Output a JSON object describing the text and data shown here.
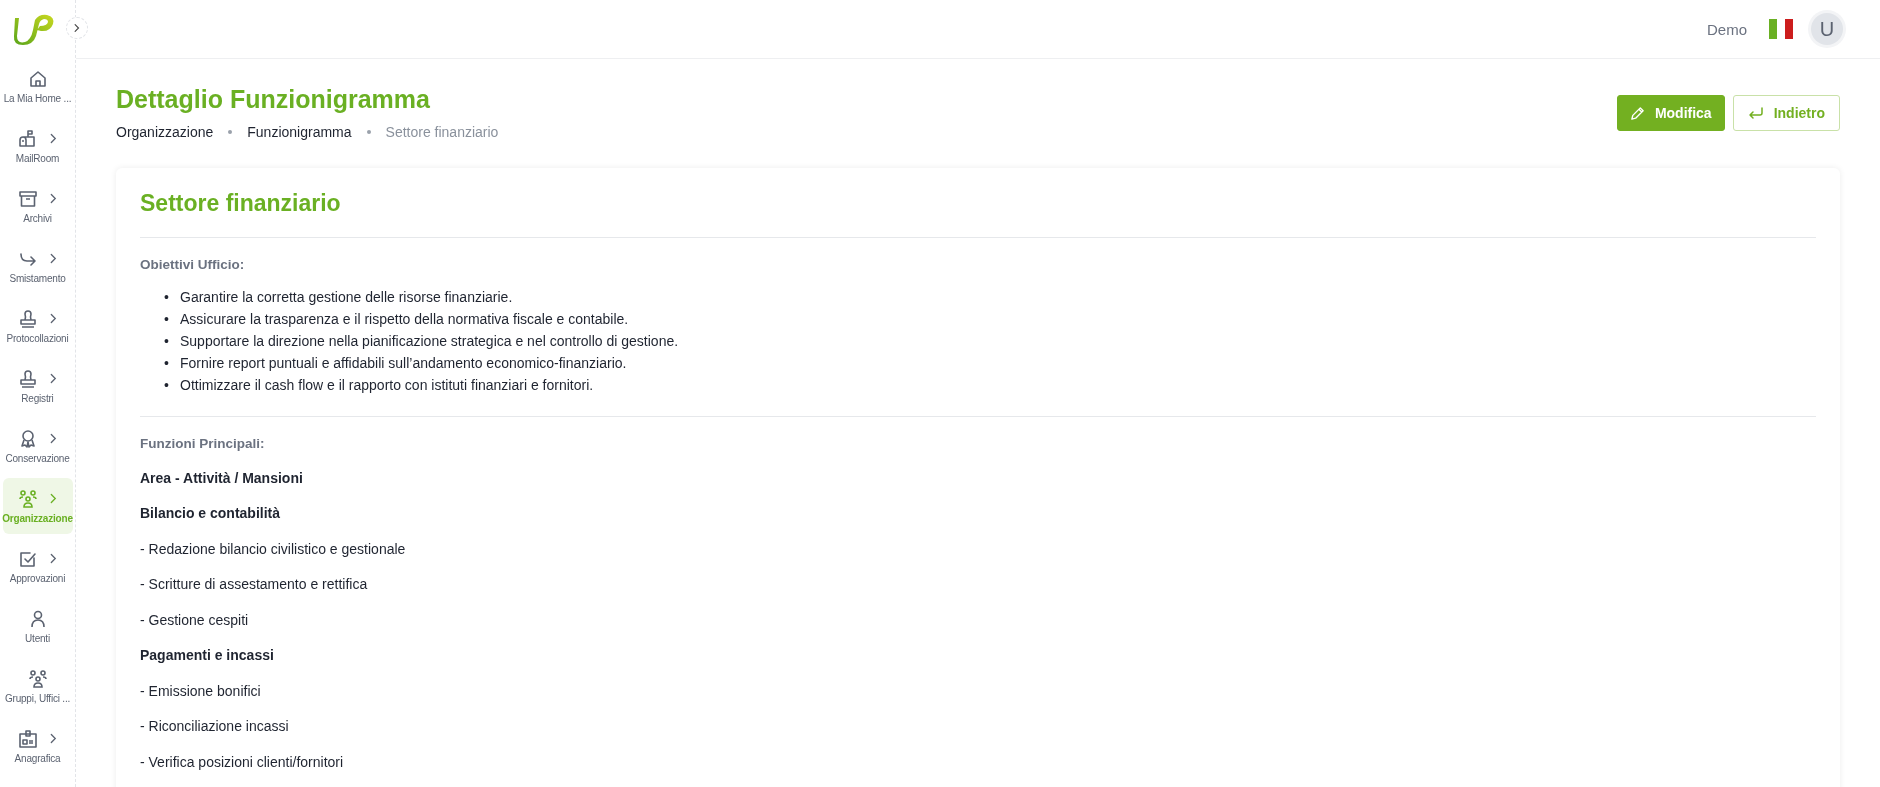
{
  "header": {
    "user_name": "Demo",
    "avatar_initial": "U"
  },
  "sidebar": {
    "items": [
      {
        "label": "La Mia Home ...",
        "submenu": false,
        "selected": false
      },
      {
        "label": "MailRoom",
        "submenu": true,
        "selected": false
      },
      {
        "label": "Archivi",
        "submenu": true,
        "selected": false
      },
      {
        "label": "Smistamento",
        "submenu": true,
        "selected": false
      },
      {
        "label": "Protocollazioni",
        "submenu": true,
        "selected": false
      },
      {
        "label": "Registri",
        "submenu": true,
        "selected": false
      },
      {
        "label": "Conservazione",
        "submenu": true,
        "selected": false
      },
      {
        "label": "Organizzazione",
        "submenu": true,
        "selected": true
      },
      {
        "label": "Approvazioni",
        "submenu": true,
        "selected": false
      },
      {
        "label": "Utenti",
        "submenu": false,
        "selected": false
      },
      {
        "label": "Gruppi, Uffici ...",
        "submenu": false,
        "selected": false
      },
      {
        "label": "Anagrafica",
        "submenu": true,
        "selected": false
      }
    ]
  },
  "page": {
    "title": "Dettaglio Funzionigramma",
    "breadcrumb": [
      {
        "label": "Organizzazione",
        "current": false
      },
      {
        "label": "Funzionigramma",
        "current": false
      },
      {
        "label": "Settore finanziario",
        "current": true
      }
    ],
    "buttons": [
      {
        "label": "Modifica",
        "kind": "primary"
      },
      {
        "label": "Indietro",
        "kind": "outline"
      }
    ]
  },
  "card": {
    "title": "Settore finanziario",
    "objectives": {
      "label": "Obiettivi Ufficio:",
      "items": [
        {
          "marker": "•",
          "text": "Garantire la corretta gestione delle risorse finanziarie."
        },
        {
          "marker": "•",
          "text": "Assicurare la trasparenza e il rispetto della normativa fiscale e contabile."
        },
        {
          "marker": "•",
          "text": "Supportare la direzione nella pianificazione strategica e nel controllo di gestione."
        },
        {
          "marker": "•",
          "text": "Fornire report puntuali e affidabili sull’andamento economico-finanziario."
        },
        {
          "marker": "•",
          "text": "Ottimizzare il cash flow e il rapporto con istituti finanziari e fornitori."
        }
      ]
    },
    "functions": {
      "label": "Funzioni Principali:",
      "lines": [
        {
          "kind": "heading",
          "text": "Area - Attività / Mansioni"
        },
        {
          "kind": "heading",
          "text": "Bilancio e contabilità"
        },
        {
          "kind": "item",
          "text": "- Redazione bilancio civilistico e gestionale"
        },
        {
          "kind": "item",
          "text": "- Scritture di assestamento e rettifica"
        },
        {
          "kind": "item",
          "text": "- Gestione cespiti"
        },
        {
          "kind": "heading",
          "text": "Pagamenti e incassi"
        },
        {
          "kind": "item",
          "text": "- Emissione bonifici"
        },
        {
          "kind": "item",
          "text": "- Riconciliazione incassi"
        },
        {
          "kind": "item",
          "text": "- Verifica posizioni clienti/fornitori"
        }
      ]
    }
  }
}
